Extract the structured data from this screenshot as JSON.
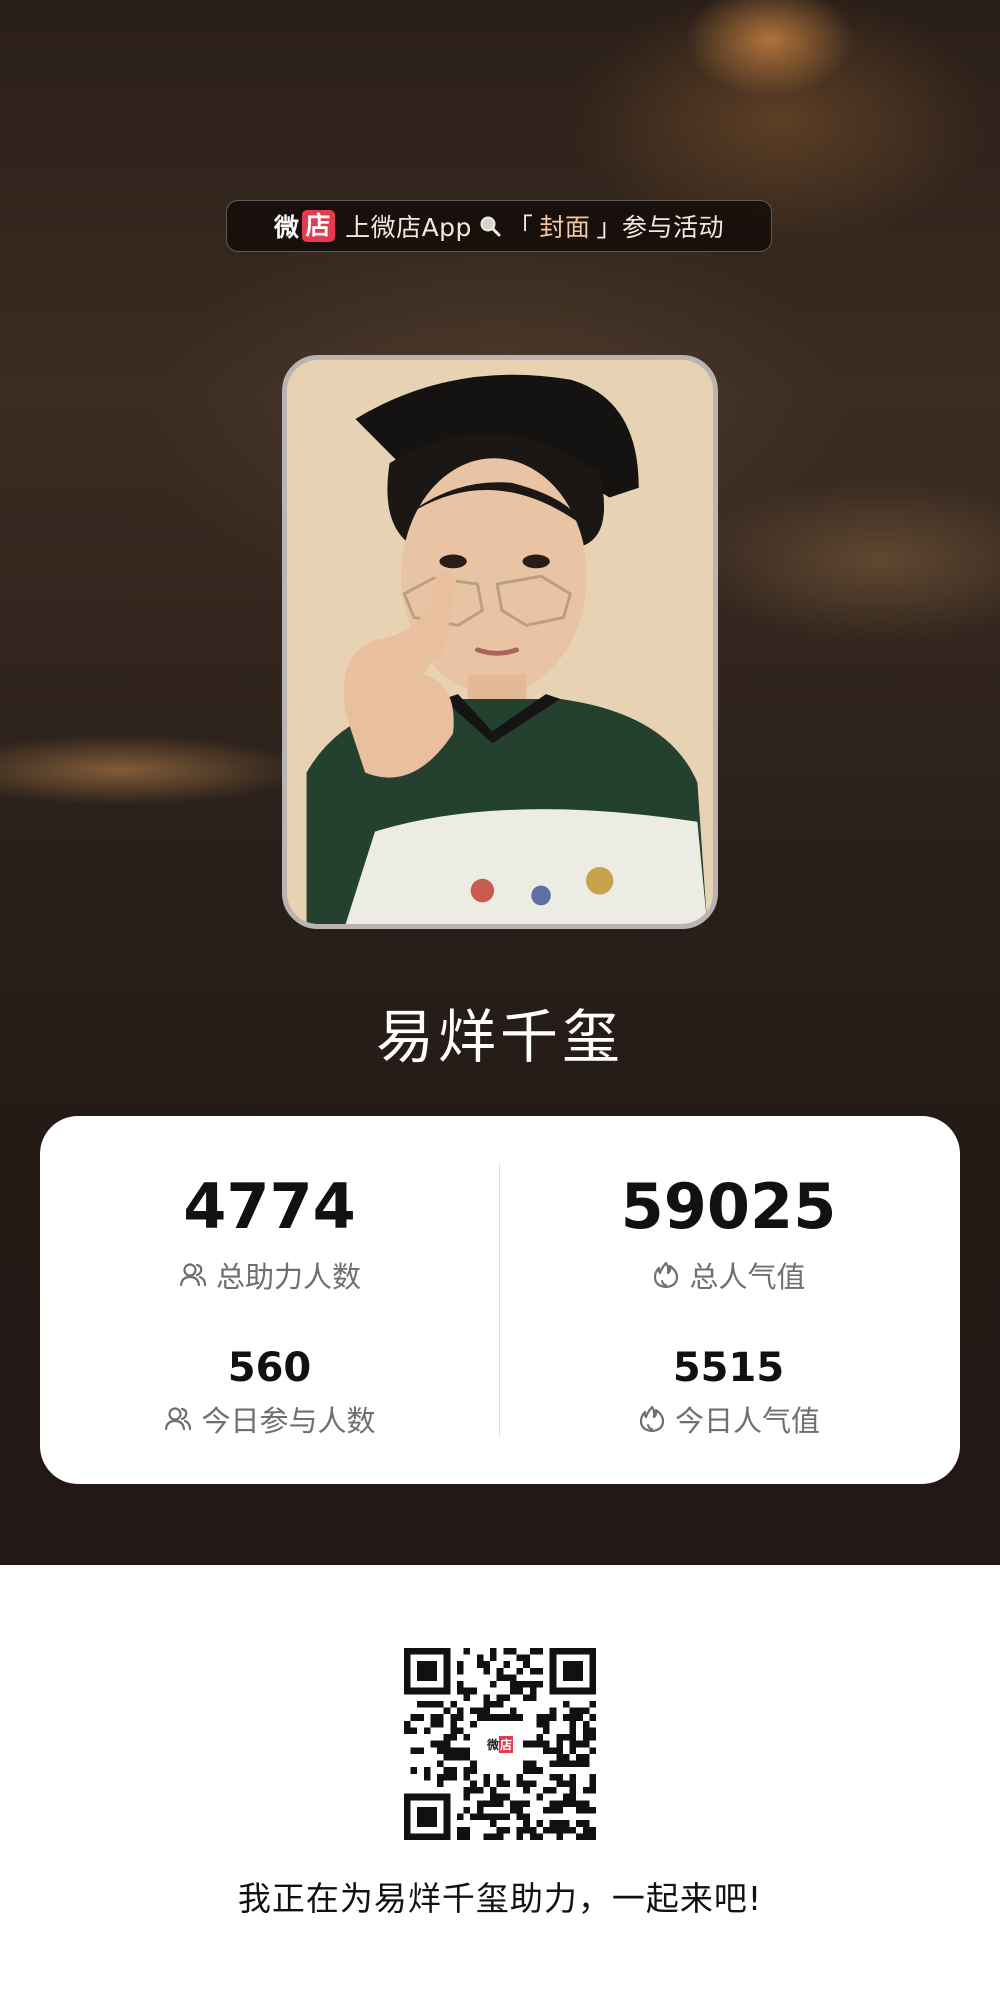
{
  "banner": {
    "brand_wei": "微",
    "brand_dian": "店",
    "text_before": "上微店App",
    "bracket_open": "「",
    "keyword": "封面",
    "bracket_close": "」",
    "text_after": "参与活动"
  },
  "profile": {
    "name": "易烊千玺"
  },
  "stats": {
    "total_supporters": {
      "value": "4774",
      "label": "总助力人数",
      "icon": "users-icon"
    },
    "total_popularity": {
      "value": "59025",
      "label": "总人气值",
      "icon": "flame-icon"
    },
    "today_participants": {
      "value": "560",
      "label": "今日参与人数",
      "icon": "users-icon"
    },
    "today_popularity": {
      "value": "5515",
      "label": "今日人气值",
      "icon": "flame-icon"
    }
  },
  "qr": {
    "logo_wei": "微",
    "logo_dian": "店"
  },
  "share_text": "我正在为易烊千玺助力，一起来吧!",
  "colors": {
    "brand_red": "#e23b4e",
    "background_dark": "#231a16",
    "card_bg": "#ffffff",
    "keyword_accent": "#f0c7a2"
  }
}
